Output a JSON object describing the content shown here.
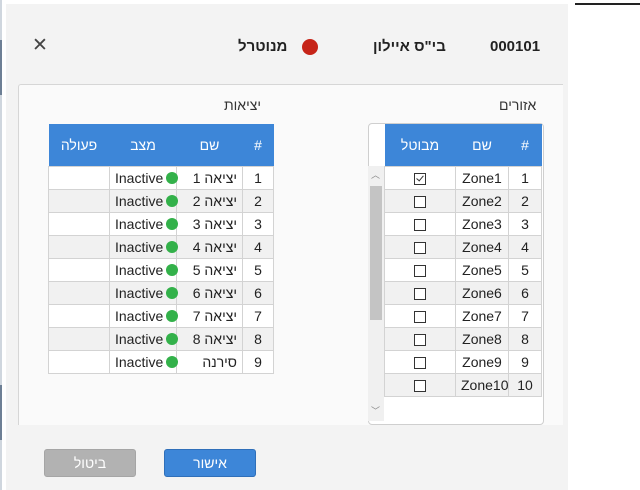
{
  "header": {
    "system_id": "000101",
    "title": "בי\"ס איילון",
    "status_label": "מנוטרל",
    "status_color": "#c62418"
  },
  "zones": {
    "title": "אזורים",
    "columns": {
      "num": "#",
      "name": "שם",
      "armed": "מבוטל"
    },
    "rows": [
      {
        "num": "1",
        "name": "Zone1",
        "armed": true
      },
      {
        "num": "2",
        "name": "Zone2",
        "armed": false
      },
      {
        "num": "3",
        "name": "Zone3",
        "armed": false
      },
      {
        "num": "4",
        "name": "Zone4",
        "armed": false
      },
      {
        "num": "5",
        "name": "Zone5",
        "armed": false
      },
      {
        "num": "6",
        "name": "Zone6",
        "armed": false
      },
      {
        "num": "7",
        "name": "Zone7",
        "armed": false
      },
      {
        "num": "8",
        "name": "Zone8",
        "armed": false
      },
      {
        "num": "9",
        "name": "Zone9",
        "armed": false
      },
      {
        "num": "10",
        "name": "Zone10",
        "armed": false
      }
    ]
  },
  "outputs": {
    "title": "יציאות",
    "columns": {
      "num": "#",
      "name": "שם",
      "state": "מצב",
      "action": "פעולה"
    },
    "rows": [
      {
        "num": "1",
        "name": "יציאה 1",
        "state": "Inactive"
      },
      {
        "num": "2",
        "name": "יציאה 2",
        "state": "Inactive"
      },
      {
        "num": "3",
        "name": "יציאה 3",
        "state": "Inactive"
      },
      {
        "num": "4",
        "name": "יציאה 4",
        "state": "Inactive"
      },
      {
        "num": "5",
        "name": "יציאה 5",
        "state": "Inactive"
      },
      {
        "num": "6",
        "name": "יציאה 6",
        "state": "Inactive"
      },
      {
        "num": "7",
        "name": "יציאה 7",
        "state": "Inactive"
      },
      {
        "num": "8",
        "name": "יציאה 8",
        "state": "Inactive"
      },
      {
        "num": "9",
        "name": "סירנה",
        "state": "Inactive"
      }
    ],
    "state_color": "#33b14a"
  },
  "buttons": {
    "ok": "אישור",
    "cancel": "ביטול"
  },
  "colors": {
    "accent": "#3d86d8",
    "disabled": "#b2b2b2"
  }
}
